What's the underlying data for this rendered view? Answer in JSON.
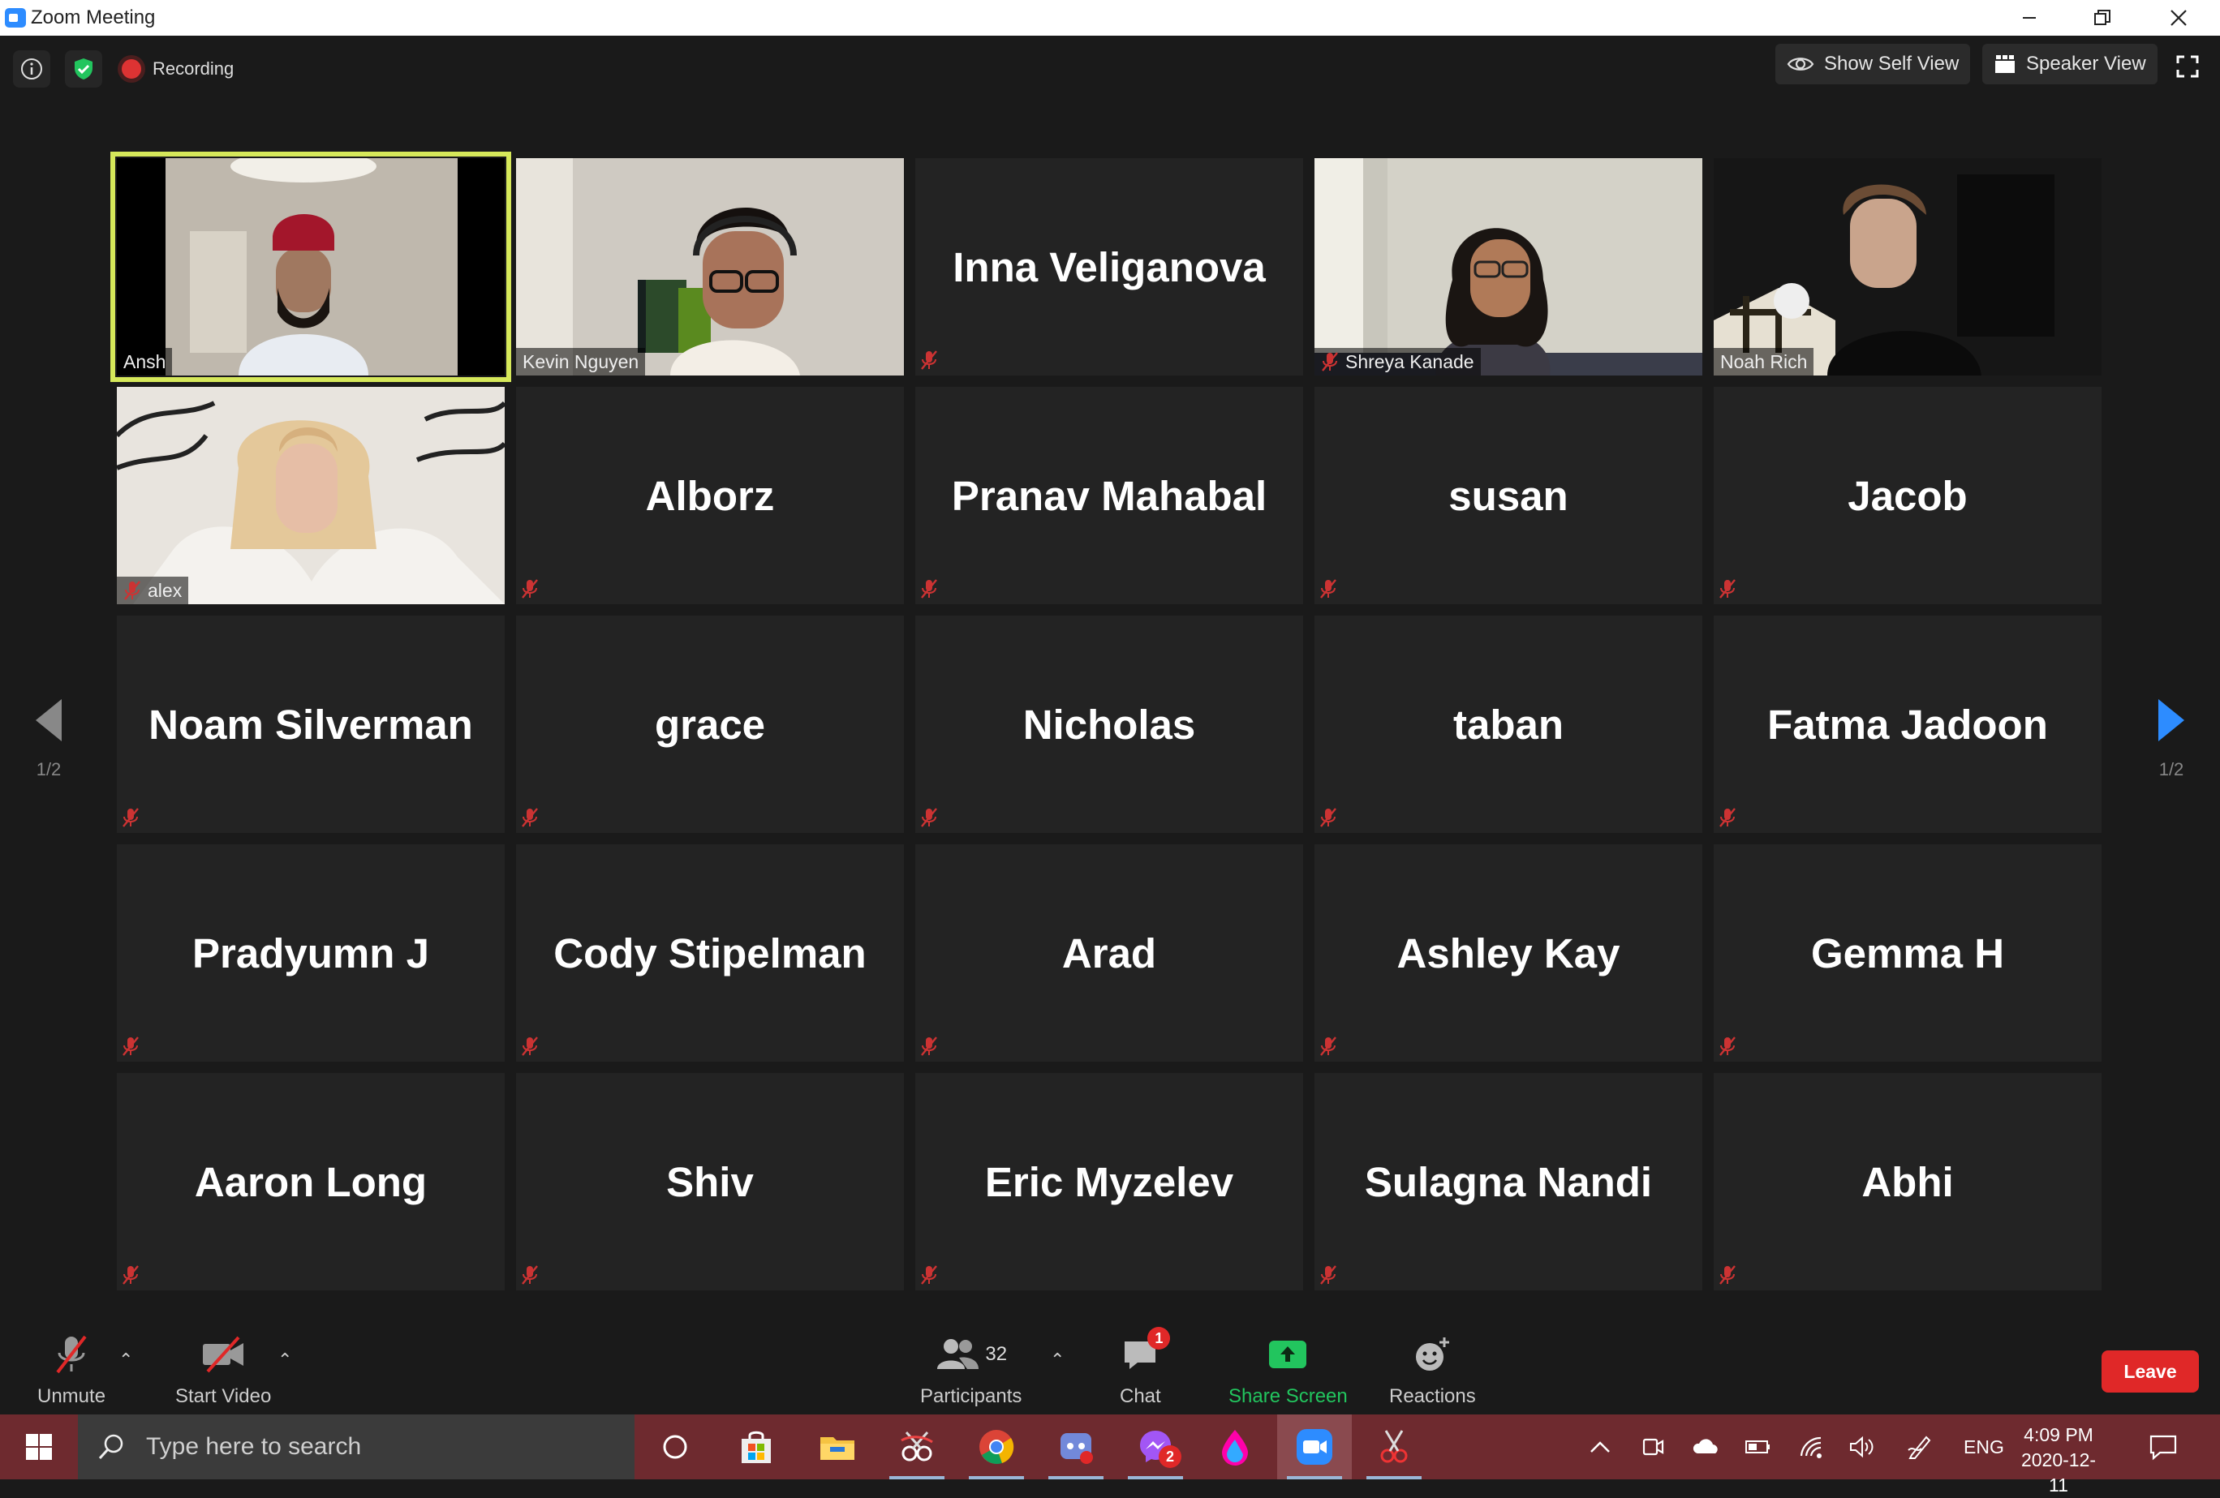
{
  "window": {
    "title": "Zoom Meeting"
  },
  "topbar": {
    "recording_label": "Recording",
    "self_view_label": "Show Self View",
    "speaker_view_label": "Speaker View"
  },
  "participants": [
    {
      "name": "Ansh",
      "video": true
    },
    {
      "name": "Kevin Nguyen",
      "video": true
    },
    {
      "name": "Inna Veliganova",
      "video": false
    },
    {
      "name": "Shreya Kanade",
      "video": true
    },
    {
      "name": "Noah Rich",
      "video": true
    },
    {
      "name": "alex",
      "video": true
    },
    {
      "name": "Alborz",
      "video": false
    },
    {
      "name": "Pranav Mahabal",
      "video": false
    },
    {
      "name": "susan",
      "video": false
    },
    {
      "name": "Jacob",
      "video": false
    },
    {
      "name": "Noam Silverman",
      "video": false
    },
    {
      "name": "grace",
      "video": false
    },
    {
      "name": "Nicholas",
      "video": false
    },
    {
      "name": "taban",
      "video": false
    },
    {
      "name": "Fatma Jadoon",
      "video": false
    },
    {
      "name": "Pradyumn J",
      "video": false
    },
    {
      "name": "Cody Stipelman",
      "video": false
    },
    {
      "name": "Arad",
      "video": false
    },
    {
      "name": "Ashley Kay",
      "video": false
    },
    {
      "name": "Gemma H",
      "video": false
    },
    {
      "name": "Aaron Long",
      "video": false
    },
    {
      "name": "Shiv",
      "video": false
    },
    {
      "name": "Eric Myzelev",
      "video": false
    },
    {
      "name": "Sulagna Nandi",
      "video": false
    },
    {
      "name": "Abhi",
      "video": false
    }
  ],
  "gallery": {
    "page_left": "1/2",
    "page_right": "1/2"
  },
  "controls": {
    "unmute": "Unmute",
    "start_video": "Start Video",
    "participants": "Participants",
    "participants_count": "32",
    "chat": "Chat",
    "chat_badge": "1",
    "share": "Share Screen",
    "reactions": "Reactions",
    "leave": "Leave"
  },
  "taskbar": {
    "search_placeholder": "Type here to search",
    "messenger_badge": "2",
    "language": "ENG",
    "time": "4:09 PM",
    "date": "2020-12-11"
  },
  "colors": {
    "active_speaker": "#d6e85a",
    "leave": "#e02828",
    "share": "#22c55e",
    "taskbar": "#6e2a2f"
  }
}
